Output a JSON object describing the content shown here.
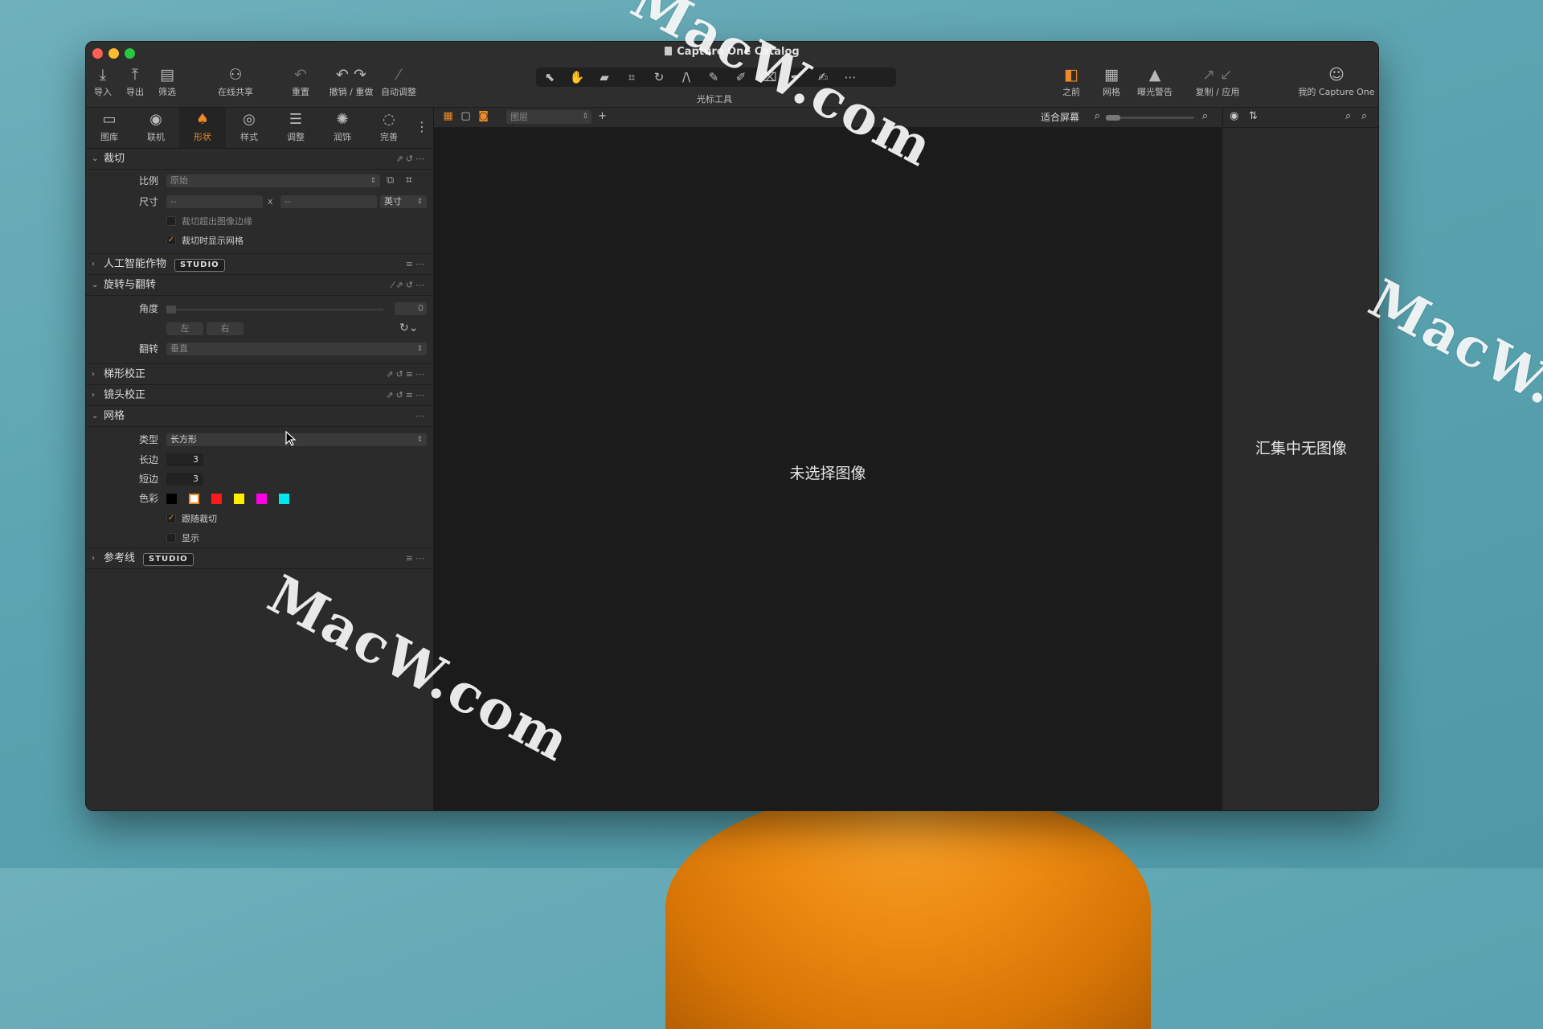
{
  "window": {
    "title": "Capture One Catalog"
  },
  "toolbar": {
    "import": "导入",
    "export": "导出",
    "filter": "筛选",
    "share": "在线共享",
    "reset": "重置",
    "undo_redo": "撤销 / 重做",
    "auto_adjust": "自动调整",
    "cursor_tools": "光标工具",
    "before": "之前",
    "grid": "网格",
    "exposure_warning": "曝光警告",
    "copy_apply": "复制 / 应用",
    "account": "我的 Capture One"
  },
  "tabs": [
    "图库",
    "联机",
    "形状",
    "样式",
    "调整",
    "润饰",
    "完善"
  ],
  "crop": {
    "title": "裁切",
    "ratio_label": "比例",
    "ratio_value": "原始",
    "size_label": "尺寸",
    "w_value": "--",
    "h_value": "--",
    "x_sep": "x",
    "unit": "英寸",
    "opt1": "裁切超出图像边缘",
    "opt2": "裁切时显示网格"
  },
  "ai": {
    "title": "人工智能作物",
    "badge": "STUDIO"
  },
  "rotate": {
    "title": "旋转与翻转",
    "angle_label": "角度",
    "angle_value": "0",
    "left": "左",
    "right": "右",
    "flip_label": "翻转",
    "flip_value": "垂直"
  },
  "keystone": {
    "title": "梯形校正"
  },
  "lens": {
    "title": "镜头校正"
  },
  "grid": {
    "title": "网格",
    "type_label": "类型",
    "type_value": "长方形",
    "long_label": "长边",
    "long_value": "3",
    "short_label": "短边",
    "short_value": "3",
    "color_label": "色彩",
    "colors": [
      "#000000",
      "#ffffff",
      "#ff1a1a",
      "#ffee00",
      "#ff00e6",
      "#00e5ee"
    ],
    "follow_crop": "跟随裁切",
    "show": "显示"
  },
  "guides": {
    "title": "参考线",
    "badge": "STUDIO"
  },
  "viewer": {
    "layer": "图层",
    "fit": "适合屏幕",
    "empty": "未选择图像"
  },
  "browser": {
    "empty": "汇集中无图像"
  },
  "watermarks": [
    "MacW.com",
    "MacW.com",
    "MacW.com"
  ]
}
